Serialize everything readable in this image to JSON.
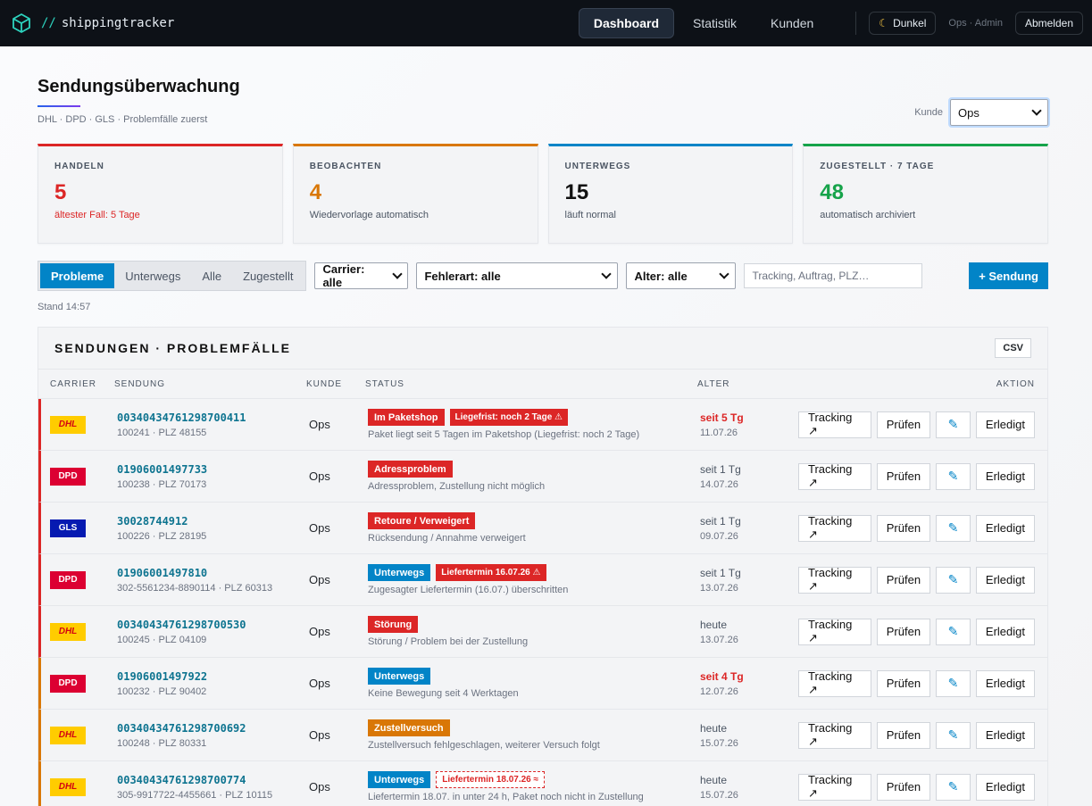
{
  "app": {
    "name": "shippingtracker",
    "prefix": "//"
  },
  "nav": {
    "items": [
      "Dashboard",
      "Statistik",
      "Kunden"
    ],
    "dark_label": "Dunkel",
    "user": "Ops · Admin",
    "logout": "Abmelden"
  },
  "page": {
    "title": "Sendungsüberwachung",
    "subtitle": "DHL · DPD · GLS · Problemfälle zuerst",
    "kunde_label": "Kunde",
    "kunde_value": "Ops"
  },
  "cards": [
    {
      "label": "HANDELN",
      "value": "5",
      "note": "ältester Fall: 5 Tage",
      "color": "#dc2626"
    },
    {
      "label": "BEOBACHTEN",
      "value": "4",
      "note": "Wiedervorlage automatisch",
      "color": "#d97706"
    },
    {
      "label": "UNTERWEGS",
      "value": "15",
      "note": "läuft normal",
      "color": "#0284c7"
    },
    {
      "label": "ZUGESTELLT · 7 TAGE",
      "value": "48",
      "note": "automatisch archiviert",
      "color": "#16a34a"
    }
  ],
  "toolbar": {
    "tabs": [
      "Probleme",
      "Unterwegs",
      "Alle",
      "Zugestellt"
    ],
    "carrier": "Carrier: alle",
    "fehler": "Fehlerart: alle",
    "alter": "Alter: alle",
    "search_placeholder": "Tracking, Auftrag, PLZ…",
    "add": "+ Sendung",
    "stand": "Stand 14:57"
  },
  "table": {
    "title": "SENDUNGEN · PROBLEMFÄLLE",
    "csv": "CSV",
    "columns": [
      "CARRIER",
      "SENDUNG",
      "KUNDE",
      "STATUS",
      "ALTER",
      "AKTION"
    ],
    "actions": {
      "tracking": "Tracking ↗",
      "pruefen": "Prüfen",
      "erledigt": "Erledigt"
    },
    "rows": [
      {
        "carrier": "DHL",
        "id": "00340434761298700411",
        "sub": "100241 · PLZ 48155",
        "kunde": "Ops",
        "badge": "Im Paketshop",
        "badge_color": "#dc2626",
        "tag": "Liegefrist: noch 2 Tage ⚠",
        "tag_style": "solid",
        "status": "Paket liegt seit 5 Tagen im Paketshop (Liegefrist: noch 2 Tage)",
        "age": "seit 5 Tg",
        "age_warn": true,
        "date": "11.07.26",
        "edge": "#dc2626"
      },
      {
        "carrier": "DPD",
        "id": "01906001497733",
        "sub": "100238 · PLZ 70173",
        "kunde": "Ops",
        "badge": "Adressproblem",
        "badge_color": "#dc2626",
        "tag": "",
        "tag_style": "",
        "status": "Adressproblem, Zustellung nicht möglich",
        "age": "seit 1 Tg",
        "age_warn": false,
        "date": "14.07.26",
        "edge": "#dc2626"
      },
      {
        "carrier": "GLS",
        "id": "30028744912",
        "sub": "100226 · PLZ 28195",
        "kunde": "Ops",
        "badge": "Retoure / Verweigert",
        "badge_color": "#dc2626",
        "tag": "",
        "tag_style": "",
        "status": "Rücksendung / Annahme verweigert",
        "age": "seit 1 Tg",
        "age_warn": false,
        "date": "09.07.26",
        "edge": "#dc2626"
      },
      {
        "carrier": "DPD",
        "id": "01906001497810",
        "sub": "302-5561234-8890114 · PLZ 60313",
        "kunde": "Ops",
        "badge": "Unterwegs",
        "badge_color": "#0284c7",
        "tag": "Liefertermin 16.07.26 ⚠",
        "tag_style": "solid",
        "status": "Zugesagter Liefertermin (16.07.) überschritten",
        "age": "seit 1 Tg",
        "age_warn": false,
        "date": "13.07.26",
        "edge": "#dc2626"
      },
      {
        "carrier": "DHL",
        "id": "00340434761298700530",
        "sub": "100245 · PLZ 04109",
        "kunde": "Ops",
        "badge": "Störung",
        "badge_color": "#dc2626",
        "tag": "",
        "tag_style": "",
        "status": "Störung / Problem bei der Zustellung",
        "age": "heute",
        "age_warn": false,
        "date": "13.07.26",
        "edge": "#dc2626"
      },
      {
        "carrier": "DPD",
        "id": "01906001497922",
        "sub": "100232 · PLZ 90402",
        "kunde": "Ops",
        "badge": "Unterwegs",
        "badge_color": "#0284c7",
        "tag": "",
        "tag_style": "",
        "status": "Keine Bewegung seit 4 Werktagen",
        "age": "seit 4 Tg",
        "age_warn": true,
        "date": "12.07.26",
        "edge": "#d97706"
      },
      {
        "carrier": "DHL",
        "id": "00340434761298700692",
        "sub": "100248 · PLZ 80331",
        "kunde": "Ops",
        "badge": "Zustellversuch",
        "badge_color": "#d97706",
        "tag": "",
        "tag_style": "",
        "status": "Zustellversuch fehlgeschlagen, weiterer Versuch folgt",
        "age": "heute",
        "age_warn": false,
        "date": "15.07.26",
        "edge": "#d97706"
      },
      {
        "carrier": "DHL",
        "id": "00340434761298700774",
        "sub": "305-9917722-4455661 · PLZ 10115",
        "kunde": "Ops",
        "badge": "Unterwegs",
        "badge_color": "#0284c7",
        "tag": "Liefertermin 18.07.26 ≈",
        "tag_style": "dashed",
        "status": "Liefertermin 18.07. in unter 24 h, Paket noch nicht in Zustellung",
        "age": "heute",
        "age_warn": false,
        "date": "15.07.26",
        "edge": "#d97706"
      }
    ]
  }
}
